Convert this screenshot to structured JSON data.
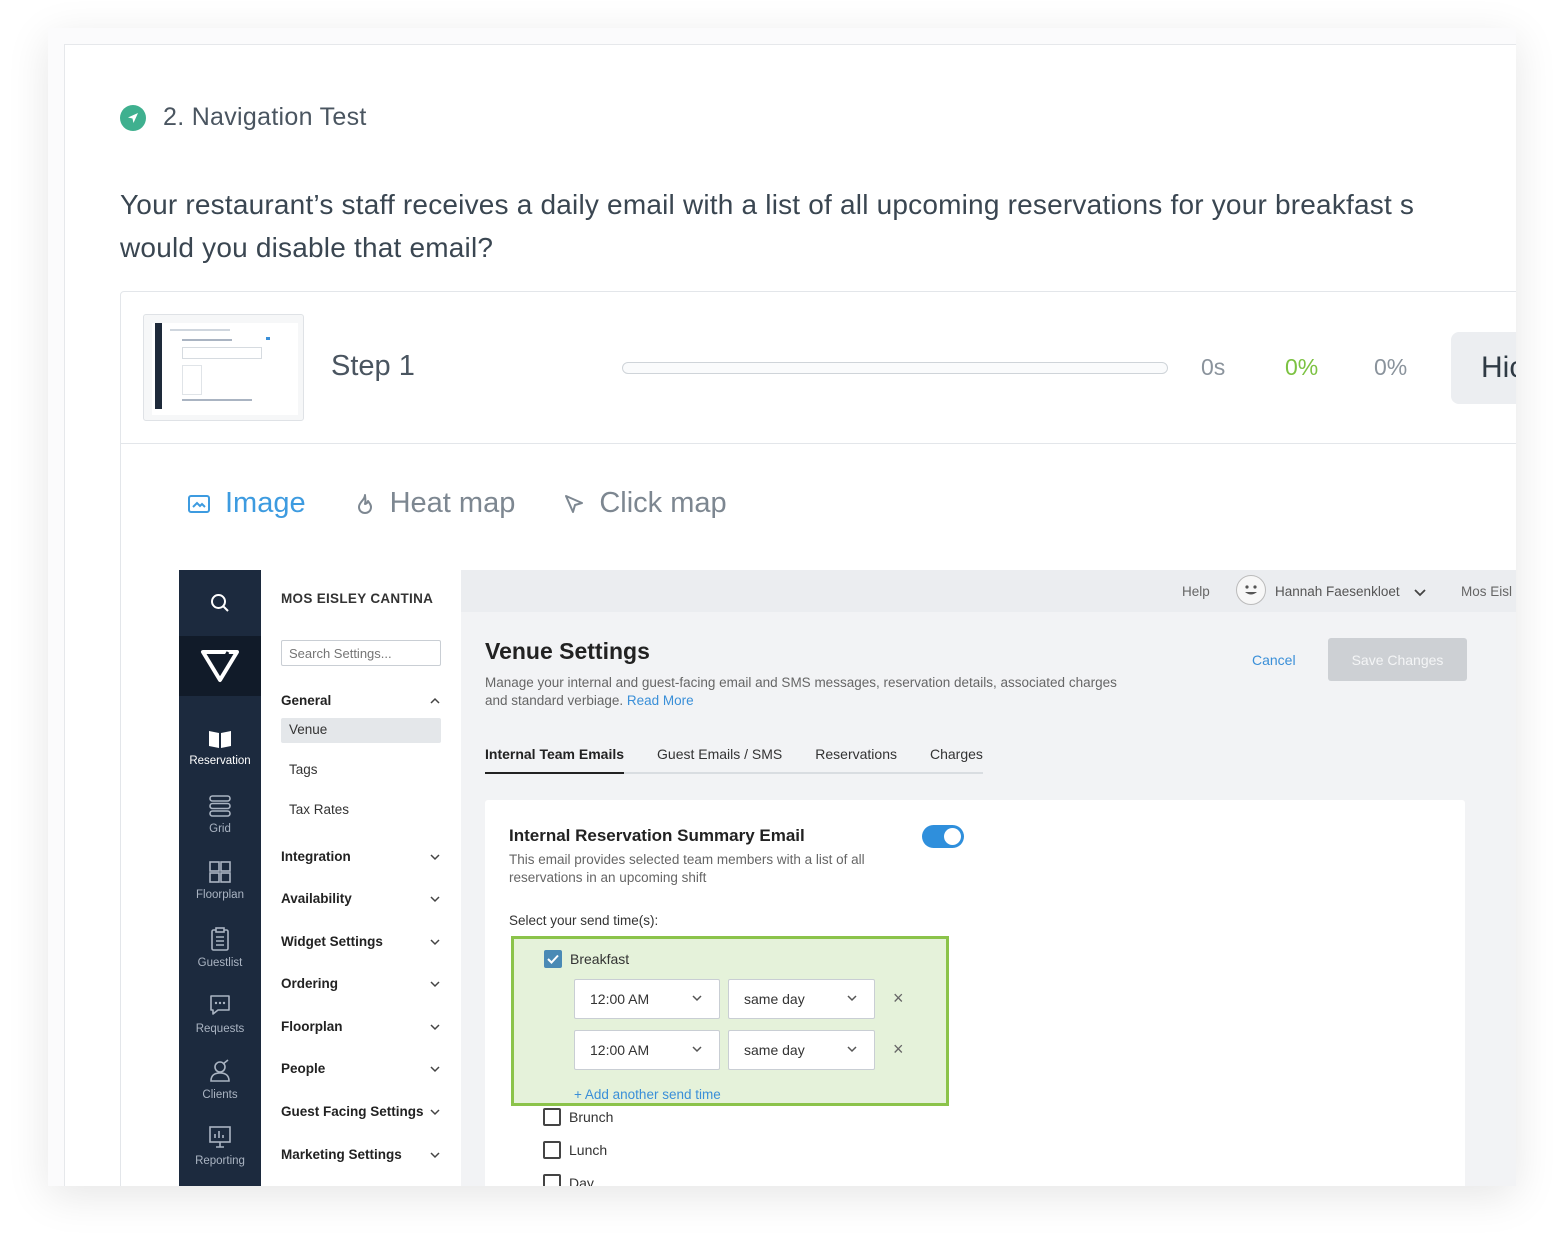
{
  "question": {
    "title": "2. Navigation Test",
    "text_line1": "Your restaurant’s staff receives a daily email with a list of all upcoming reservations for your breakfast s",
    "text_line2": "would you disable that email?"
  },
  "step": {
    "label": "Step 1",
    "progress": 0,
    "time": "0s",
    "success_pct": "0%",
    "other_pct": "0%",
    "hide_label": "Hic"
  },
  "view_tabs": [
    {
      "label": "Image",
      "active": true,
      "icon": "image-icon"
    },
    {
      "label": "Heat map",
      "active": false,
      "icon": "flame-icon"
    },
    {
      "label": "Click map",
      "active": false,
      "icon": "cursor-icon"
    }
  ],
  "app": {
    "rail": [
      {
        "label": "Reservation",
        "icon": "book-icon",
        "active": true
      },
      {
        "label": "Grid",
        "icon": "grid-icon"
      },
      {
        "label": "Floorplan",
        "icon": "floorplan-icon"
      },
      {
        "label": "Guestlist",
        "icon": "clipboard-icon"
      },
      {
        "label": "Requests",
        "icon": "chat-icon"
      },
      {
        "label": "Clients",
        "icon": "clients-icon"
      },
      {
        "label": "Reporting",
        "icon": "reporting-icon"
      }
    ],
    "venue_name": "MOS EISLEY CANTINA",
    "search_placeholder": "Search Settings...",
    "settings": {
      "general": "General",
      "general_items": [
        "Venue",
        "Tags",
        "Tax Rates"
      ],
      "groups": [
        "Integration",
        "Availability",
        "Widget Settings",
        "Ordering",
        "Floorplan",
        "People",
        "Guest Facing Settings",
        "Marketing Settings"
      ]
    },
    "topbar": {
      "help": "Help",
      "user": "Hannah Faesenkloet",
      "venue": "Mos Eisl"
    },
    "page": {
      "title": "Venue Settings",
      "desc": "Manage your internal and guest-facing email and SMS messages, reservation details, associated charges and standard verbiage.",
      "read_more": "Read More",
      "cancel": "Cancel",
      "save": "Save Changes",
      "tabs": [
        "Internal Team Emails",
        "Guest Emails / SMS",
        "Reservations",
        "Charges"
      ]
    },
    "email": {
      "title": "Internal Reservation Summary Email",
      "enabled": true,
      "desc": "This email provides selected team members with a list of all reservations in an upcoming shift",
      "send_label": "Select your send time(s):",
      "shifts": [
        {
          "label": "Breakfast",
          "checked": true
        },
        {
          "label": "Brunch",
          "checked": false
        },
        {
          "label": "Lunch",
          "checked": false
        },
        {
          "label": "Day",
          "checked": false
        }
      ],
      "times": [
        {
          "time": "12:00 AM",
          "when": "same day"
        },
        {
          "time": "12:00 AM",
          "when": "same day"
        }
      ],
      "add_time": "+ Add another send time",
      "remove": "×"
    }
  },
  "colors": {
    "accent_blue": "#3d9be0",
    "success_green": "#7cc242",
    "highlight_green": "#8bc34a",
    "rail_navy": "#1c2a3e"
  }
}
